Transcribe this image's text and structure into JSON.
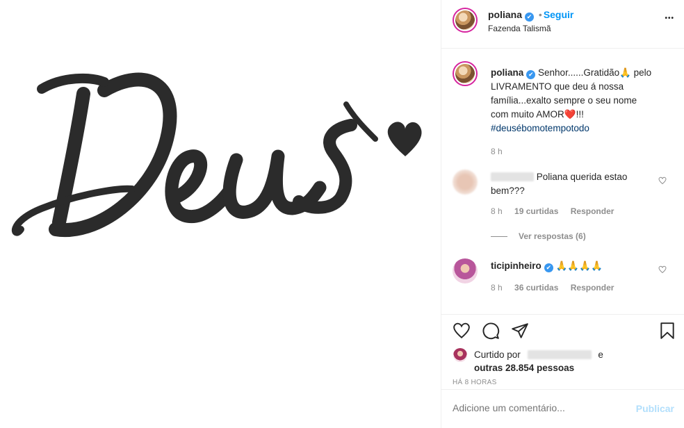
{
  "header": {
    "username": "poliana",
    "verified_mark": "✔",
    "follow_label": "Seguir",
    "follow_sep": "•",
    "location": "Fazenda Talismã",
    "more_label": "•••"
  },
  "caption": {
    "username": "poliana",
    "line1": "Senhor......Gratidão🙏 pelo",
    "line2": "LIVRAMENTO que deu á nossa",
    "line3": "família...exalto sempre o seu nome",
    "line4": "com muito AMOR❤️!!!",
    "hashtag": "#deusébomotempotodo",
    "time": "8 h"
  },
  "comments": [
    {
      "username_hidden": true,
      "text_line1": "Poliana querida estao",
      "text_line2": "bem???",
      "time": "8 h",
      "likes": "19 curtidas",
      "reply": "Responder",
      "view_replies": "Ver respostas (6)"
    },
    {
      "username": "ticipinheiro",
      "text": "🙏🙏🙏🙏",
      "time": "8 h",
      "likes": "36 curtidas",
      "reply": "Responder"
    }
  ],
  "likes": {
    "prefix": "Curtido por",
    "suffix": "e",
    "others": "outras 28.854 pessoas"
  },
  "post_time": "HÁ 8 HORAS",
  "comment_input": {
    "placeholder": "Adicione um comentário...",
    "publish": "Publicar"
  },
  "image": {
    "word": "Deus",
    "colors": {
      "ink": "#2b2b2b"
    }
  },
  "icons": {
    "like": "heart-icon",
    "comment": "comment-icon",
    "share": "share-icon",
    "save": "bookmark-icon",
    "more": "more-icon",
    "comment_like": "heart-outline-icon"
  }
}
